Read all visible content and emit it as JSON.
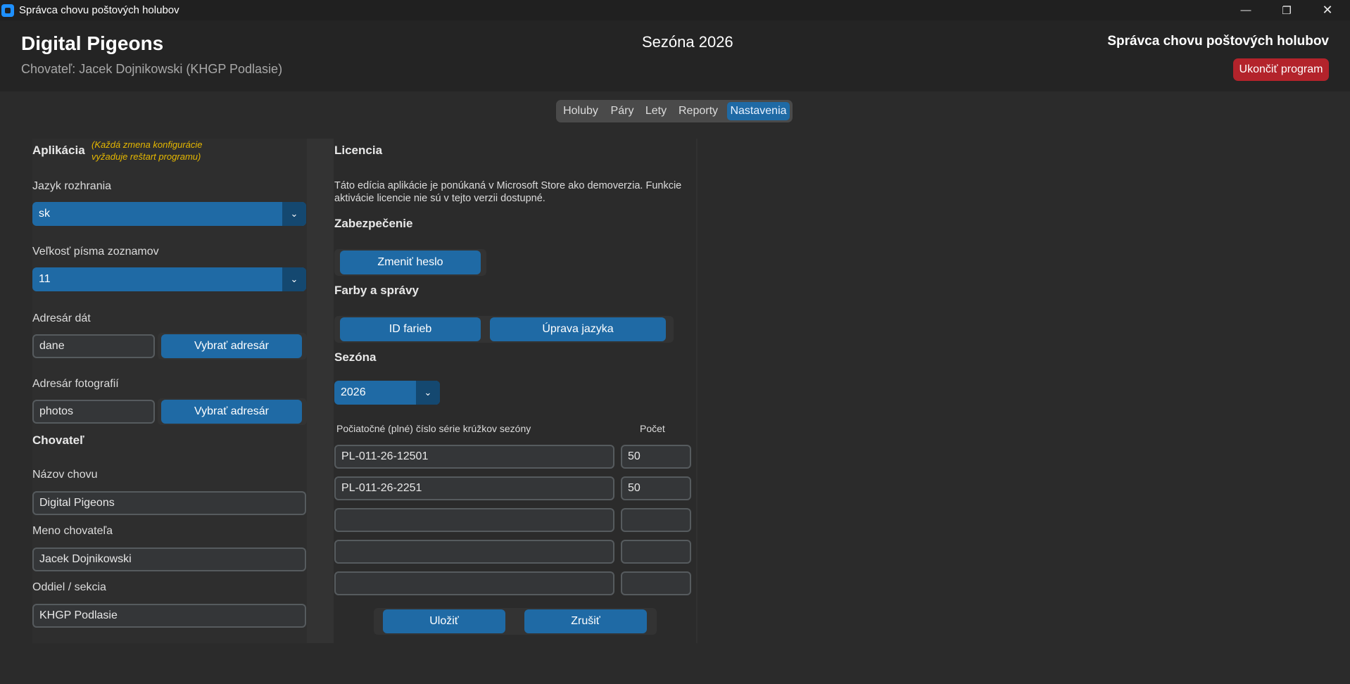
{
  "window": {
    "title": "Správca chovu poštových holubov",
    "minimize_glyph": "—",
    "restore_glyph": "❐",
    "close_glyph": "✕"
  },
  "header": {
    "brand": "Digital Pigeons",
    "breeder_line": "Chovateľ: Jacek Dojnikowski (KHGP Podlasie)",
    "season": "Sezóna 2026",
    "app_title": "Správca chovu poštových holubov",
    "quit_label": "Ukončiť program"
  },
  "tabs": [
    {
      "label": "Holuby"
    },
    {
      "label": "Páry"
    },
    {
      "label": "Lety"
    },
    {
      "label": "Reporty"
    },
    {
      "label": "Nastavenia",
      "active": true
    }
  ],
  "app_settings": {
    "title": "Aplikácia",
    "note": "(Každá zmena konfigurácie vyžaduje reštart programu)",
    "language_label": "Jazyk rozhrania",
    "language_value": "sk",
    "font_size_label": "Veľkosť písma zoznamov",
    "font_size_value": "11",
    "data_dir_label": "Adresár dát",
    "data_dir_value": "dane",
    "data_dir_button": "Vybrať adresár",
    "photo_dir_label": "Adresár fotografií",
    "photo_dir_value": "photos",
    "photo_dir_button": "Vybrať adresár",
    "dropdown_arrow": "⌄"
  },
  "breeder": {
    "title": "Chovateľ",
    "loft_name_label": "Názov chovu",
    "loft_name_value": "Digital Pigeons",
    "breeder_name_label": "Meno chovateľa",
    "breeder_name_value": "Jacek Dojnikowski",
    "section_label": "Oddiel / sekcia",
    "section_value": "KHGP Podlasie"
  },
  "license": {
    "title": "Licencia",
    "text": "Táto edícia aplikácie je ponúkaná v Microsoft Store ako demoverzia. Funkcie aktivácie licencie nie sú v tejto verzii dostupné."
  },
  "security": {
    "title": "Zabezpečenie",
    "change_password": "Zmeniť heslo"
  },
  "colors_messages": {
    "title": "Farby a správy",
    "color_ids": "ID farieb",
    "edit_language": "Úprava jazyka"
  },
  "season": {
    "title": "Sezóna",
    "value": "2026",
    "ring_series_header": "Počiatočné (plné) číslo série krúžkov sezóny",
    "count_header": "Počet",
    "rows": [
      {
        "series": "PL-011-26-12501",
        "count": "50"
      },
      {
        "series": "PL-011-26-2251",
        "count": "50"
      },
      {
        "series": "",
        "count": ""
      },
      {
        "series": "",
        "count": ""
      },
      {
        "series": "",
        "count": ""
      }
    ],
    "save": "Uložiť",
    "cancel": "Zrušiť"
  }
}
